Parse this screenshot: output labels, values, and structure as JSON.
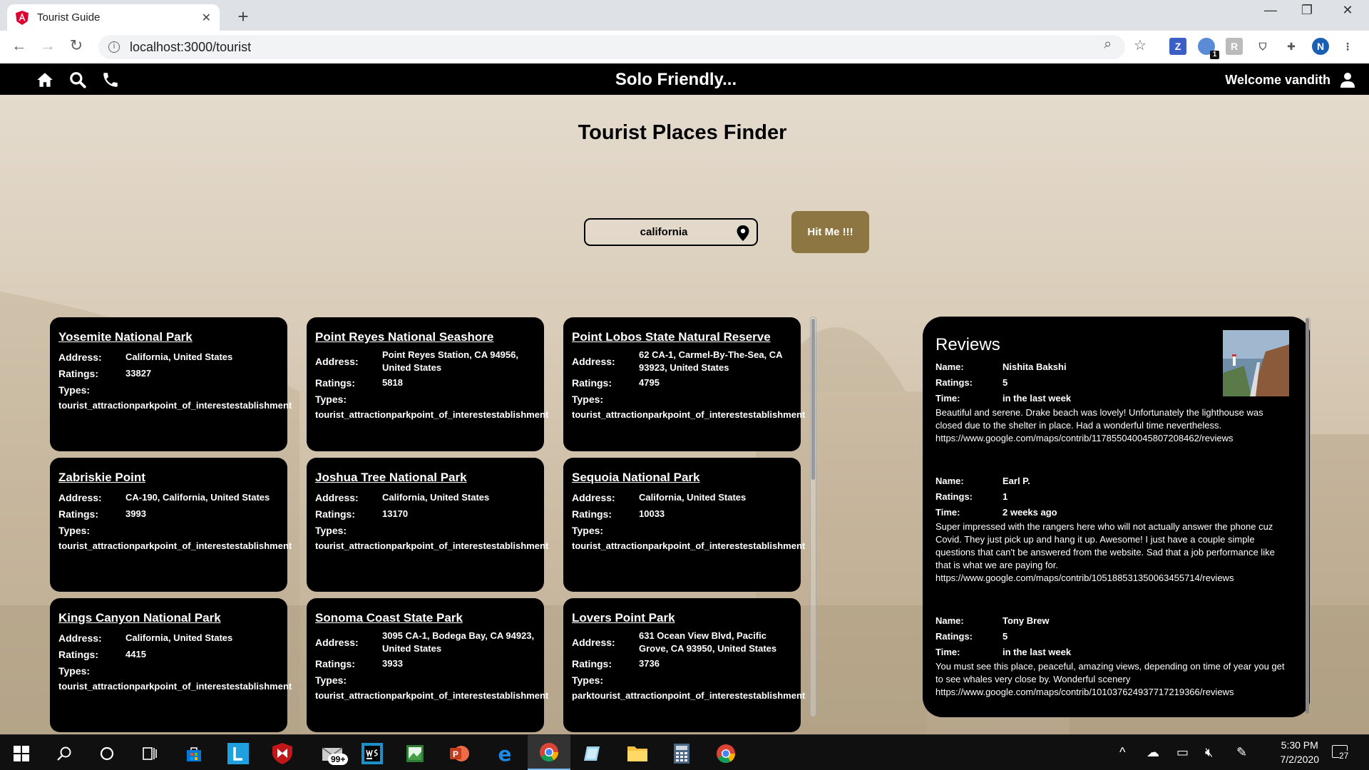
{
  "browser": {
    "tab_title": "Tourist Guide",
    "url": "localhost:3000/tourist",
    "extension_badge": "1",
    "profile_initial": "N"
  },
  "nav": {
    "brand": "Solo Friendly...",
    "welcome": "Welcome vandith"
  },
  "page": {
    "title": "Tourist Places Finder",
    "search_value": "california",
    "button_label": "Hit Me !!!"
  },
  "labels": {
    "address": "Address:",
    "ratings": "Ratings:",
    "types": "Types:",
    "name": "Name:",
    "time": "Time:"
  },
  "places": [
    {
      "name": "Yosemite National Park",
      "address": "California, United States",
      "ratings": "33827",
      "types": "tourist_attractionparkpoint_of_interestestablishment"
    },
    {
      "name": "Point Reyes National Seashore",
      "address": "Point Reyes Station, CA 94956, United States",
      "ratings": "5818",
      "types": "tourist_attractionparkpoint_of_interestestablishment"
    },
    {
      "name": "Point Lobos State Natural Reserve",
      "address": "62 CA-1, Carmel-By-The-Sea, CA 93923, United States",
      "ratings": "4795",
      "types": "tourist_attractionparkpoint_of_interestestablishment"
    },
    {
      "name": "Zabriskie Point",
      "address": "CA-190, California, United States",
      "ratings": "3993",
      "types": "tourist_attractionparkpoint_of_interestestablishment"
    },
    {
      "name": "Joshua Tree National Park",
      "address": "California, United States",
      "ratings": "13170",
      "types": "tourist_attractionparkpoint_of_interestestablishment"
    },
    {
      "name": "Sequoia National Park",
      "address": "California, United States",
      "ratings": "10033",
      "types": "tourist_attractionparkpoint_of_interestestablishment"
    },
    {
      "name": "Kings Canyon National Park",
      "address": "California, United States",
      "ratings": "4415",
      "types": "tourist_attractionparkpoint_of_interestestablishment"
    },
    {
      "name": "Sonoma Coast State Park",
      "address": "3095 CA-1, Bodega Bay, CA 94923, United States",
      "ratings": "3933",
      "types": "tourist_attractionparkpoint_of_interestestablishment"
    },
    {
      "name": "Lovers Point Park",
      "address": "631 Ocean View Blvd, Pacific Grove, CA 93950, United States",
      "ratings": "3736",
      "types": "parktourist_attractionpoint_of_interestestablishment"
    }
  ],
  "reviews": {
    "title": "Reviews",
    "items": [
      {
        "name": "Nishita Bakshi",
        "ratings": "5",
        "time": "in the last week",
        "text": "Beautiful and serene. Drake beach was lovely! Unfortunately the lighthouse was closed due to the shelter in place. Had a wonderful time nevertheless.",
        "link": "https://www.google.com/maps/contrib/117855040045807208462/reviews"
      },
      {
        "name": "Earl P.",
        "ratings": "1",
        "time": "2 weeks ago",
        "text": "Super impressed with the rangers here who will not actually answer the phone cuz Covid. They just pick up and hang it up. Awesome! I just have a couple simple questions that can't be answered from the website. Sad that a job performance like that is what we are paying for.",
        "link": "https://www.google.com/maps/contrib/105188531350063455714/reviews"
      },
      {
        "name": "Tony Brew",
        "ratings": "5",
        "time": "in the last week",
        "text": "You must see this place, peaceful, amazing views, depending on time of year you get to see whales very close by. Wonderful scenery",
        "link": "https://www.google.com/maps/contrib/101037624937717219366/reviews"
      }
    ]
  },
  "taskbar": {
    "mail_badge": "99+",
    "time": "5:30 PM",
    "date": "7/2/2020",
    "notification_count": "27"
  }
}
